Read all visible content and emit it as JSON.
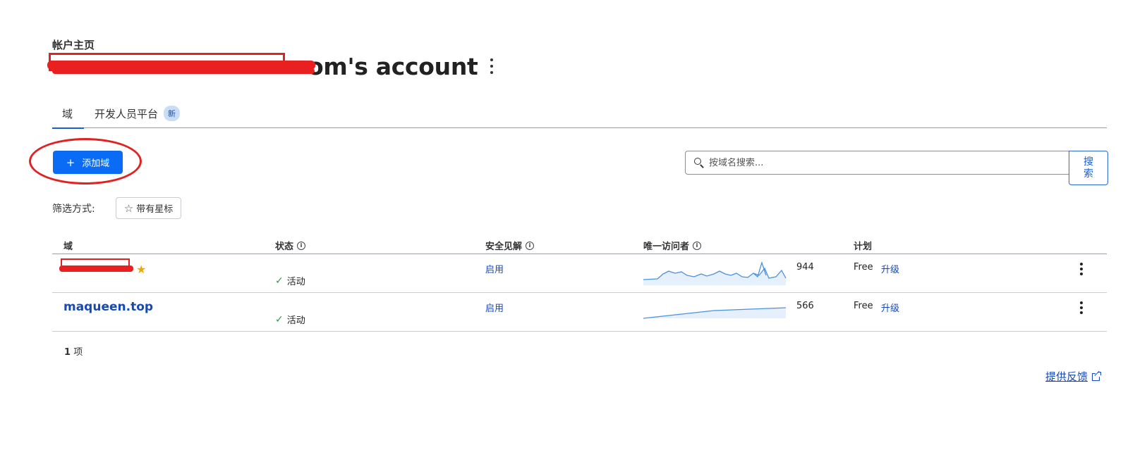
{
  "header": {
    "breadcrumb": "帐户主页",
    "account_title": "om's account"
  },
  "tabs": [
    {
      "label": "域",
      "active": true
    },
    {
      "label": "开发人员平台",
      "active": false,
      "badge": "新"
    }
  ],
  "toolbar": {
    "add_label": "添加域",
    "search_placeholder": "按域名搜索...",
    "search_button": "搜索"
  },
  "filter": {
    "label": "筛选方式:",
    "starred": "带有星标"
  },
  "table": {
    "columns": [
      "域",
      "状态",
      "安全见解",
      "唯一访问者",
      "计划"
    ],
    "rows": [
      {
        "domain": "",
        "starred": true,
        "status": "活动",
        "security": "启用",
        "visitors": "944",
        "plan": "Free",
        "upgrade": "升级"
      },
      {
        "domain": "maqueen.top",
        "starred": false,
        "status": "活动",
        "security": "启用",
        "visitors": "566",
        "plan": "Free",
        "upgrade": "升级"
      }
    ],
    "count_number": "1",
    "count_unit": "项"
  },
  "footer": {
    "feedback": "提供反馈"
  },
  "colors": {
    "primary_button": "#0a6cf5",
    "link": "#1749b5",
    "annotation_red": "#e02222",
    "sparkline": "#4a90e2"
  }
}
